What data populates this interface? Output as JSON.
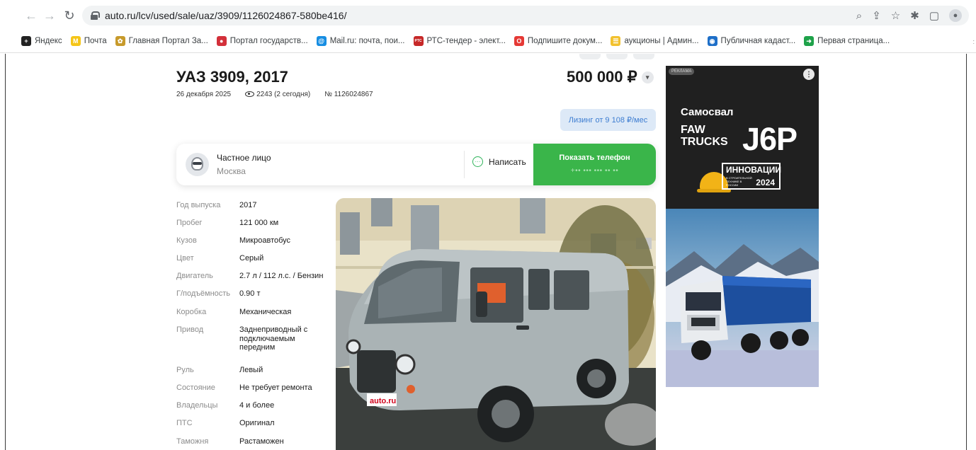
{
  "browser": {
    "url": "auto.ru/lcv/used/sale/uaz/3909/1126024867-580be416/",
    "bookmarks": [
      {
        "label": "Яндекс",
        "color": "#222222",
        "glyph": "+"
      },
      {
        "label": "Почта",
        "color": "#f5c518",
        "glyph": "M"
      },
      {
        "label": "Главная Портал За...",
        "color": "#c79a2b",
        "glyph": "✿"
      },
      {
        "label": "Портал государств...",
        "color": "#d3303a",
        "glyph": "●"
      },
      {
        "label": "Mail.ru: почта, пои...",
        "color": "#168de2",
        "glyph": "@"
      },
      {
        "label": "РТС-тендер - элект...",
        "color": "#c62828",
        "glyph": "РТС"
      },
      {
        "label": "Подпишите докум...",
        "color": "#e53935",
        "glyph": "O"
      },
      {
        "label": "аукционы | Админ...",
        "color": "#f2c12e",
        "glyph": "☰"
      },
      {
        "label": "Публичная кадаст...",
        "color": "#1e6fc8",
        "glyph": "◉"
      },
      {
        "label": "Первая страница...",
        "color": "#1fa24a",
        "glyph": "➜"
      }
    ]
  },
  "listing": {
    "title": "УАЗ 3909, 2017",
    "date": "26 декабря 2025",
    "views": "2243 (2 сегодня)",
    "number": "№ 1126024867",
    "price": "500 000 ₽",
    "leasing": "Лизинг от 9 108 ₽/мес"
  },
  "seller": {
    "type": "Частное лицо",
    "city": "Москва",
    "write_label": "Написать",
    "phone_label": "Показать телефон",
    "phone_mask": "+•• ••• ••• •• ••"
  },
  "specs": [
    {
      "key": "Год выпуска",
      "value": "2017"
    },
    {
      "key": "Пробег",
      "value": "121 000 км"
    },
    {
      "key": "Кузов",
      "value": "Микроавтобус"
    },
    {
      "key": "Цвет",
      "value": "Серый"
    },
    {
      "key": "Двигатель",
      "value": "2.7 л / 112 л.с. / Бензин"
    },
    {
      "key": "Г/подъёмность",
      "value": "0.90 т"
    },
    {
      "key": "Коробка",
      "value": "Механическая"
    },
    {
      "key": "Привод",
      "value": "Заднеприводный с подключаемым передним"
    },
    {
      "key": "Руль",
      "value": "Левый"
    },
    {
      "key": "Состояние",
      "value": "Не требует ремонта"
    },
    {
      "key": "Владельцы",
      "value": "4 и более"
    },
    {
      "key": "ПТС",
      "value": "Оригинал"
    },
    {
      "key": "Таможня",
      "value": "Растаможен"
    }
  ],
  "photo": {
    "plate_text": "auto.ru",
    "sticker_text": "МЭС"
  },
  "ad": {
    "badge": "РЕКЛАМА",
    "headline": "Самосвал",
    "brand_line1": "FAW",
    "brand_line2": "TRUCKS",
    "model": "J6P",
    "innovation": "ИННОВАЦИИ",
    "innovation_sub": "В СТРОИТЕЛЬНОЙ ТЕХНИКЕ В РОССИИ",
    "year": "2024"
  }
}
